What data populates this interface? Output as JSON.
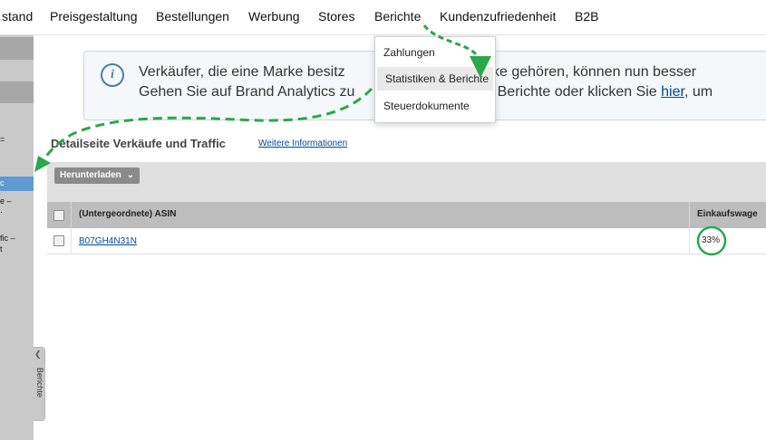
{
  "nav": {
    "items": [
      "stand",
      "Preisgestaltung",
      "Bestellungen",
      "Werbung",
      "Stores",
      "Berichte",
      "Kundenzufriedenheit",
      "B2B"
    ]
  },
  "dropdown": {
    "items": [
      "Zahlungen",
      "Statistiken & Berichte",
      "Steuerdokumente"
    ],
    "highlighted": "Statistiken & Berichte"
  },
  "banner": {
    "line1_left": "Verkäufer, die eine Marke besitz",
    "line1_right": "r Marke gehören, können nun besser",
    "line2_left": "Gehen Sie auf Brand Analytics zu",
    "line2_mid": "nü Berichte oder klicken Sie ",
    "line2_link": "hier",
    "line2_end": ", um"
  },
  "section": {
    "title": "Detailseite Verkäufe und Traffic",
    "link": "Weitere Informationen"
  },
  "toolbar": {
    "download_label": "Herunterladen"
  },
  "table": {
    "headers": [
      "(Untergeordnete) ASIN",
      "Einkaufswage"
    ],
    "rows": [
      {
        "asin": "B07GH4N31N",
        "buybox_pct": "33%"
      }
    ]
  },
  "sidebar": {
    "fragments": [
      "=",
      "c",
      "e –",
      "·",
      "fic –",
      "t"
    ],
    "handle_label": "Berichte"
  },
  "colors": {
    "annotation_green": "#2aa84a",
    "link_blue": "#004b91",
    "sidebar_active": "#5f9ad4"
  }
}
